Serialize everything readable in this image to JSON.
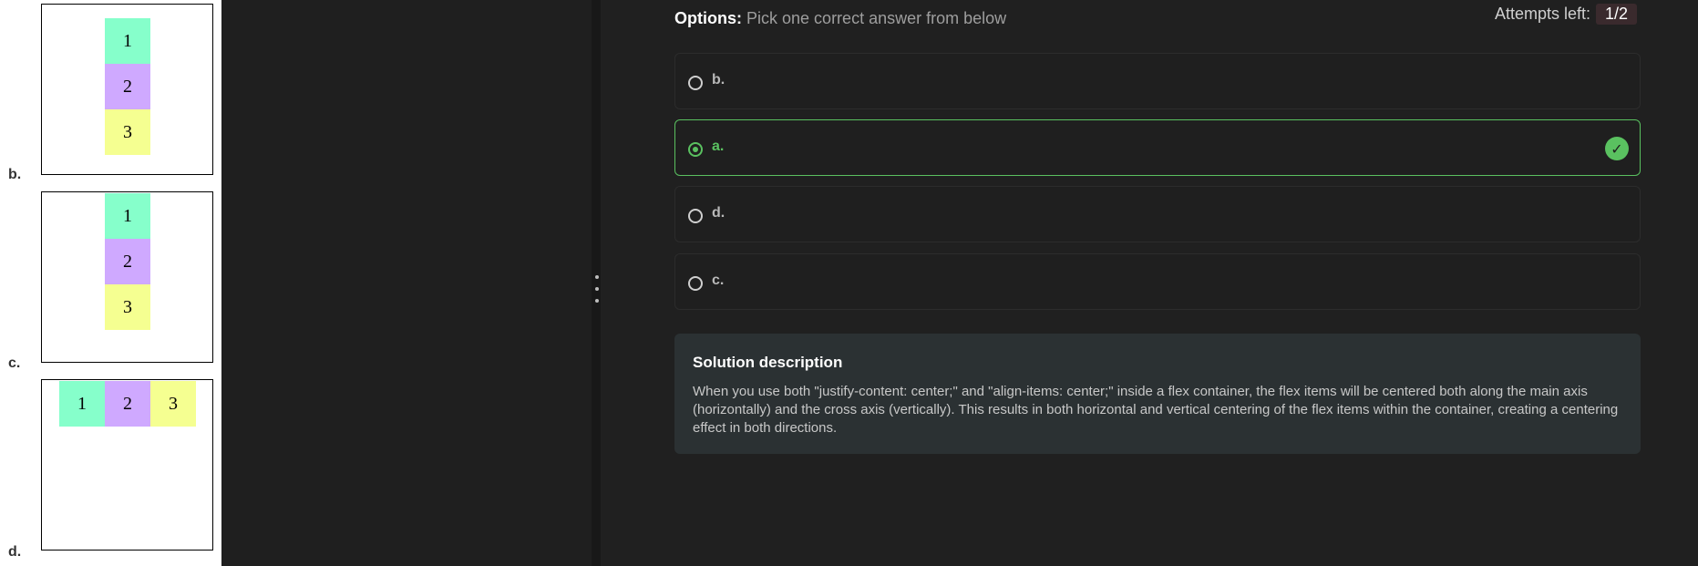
{
  "left_panel": {
    "options": [
      {
        "label": "b.",
        "cells": [
          "1",
          "2",
          "3"
        ],
        "layout": "vertical"
      },
      {
        "label": "c.",
        "cells": [
          "1",
          "2",
          "3"
        ],
        "layout": "vertical"
      },
      {
        "label": "d.",
        "cells": [
          "1",
          "2",
          "3"
        ],
        "layout": "horizontal"
      }
    ],
    "colors": {
      "green": "#86ffcb",
      "purple": "#cfa9ff",
      "yellow": "#f5ff91"
    }
  },
  "quiz": {
    "options_title": "Options:",
    "options_hint": "Pick one correct answer from below",
    "attempts_label": "Attempts left:",
    "attempts_value": "1/2",
    "answers": [
      {
        "label": "b.",
        "selected": false
      },
      {
        "label": "a.",
        "selected": true,
        "correct": true
      },
      {
        "label": "d.",
        "selected": false
      },
      {
        "label": "c.",
        "selected": false
      }
    ],
    "accent_color": "#5ac160"
  },
  "solution": {
    "title": "Solution description",
    "text": "When you use both \"justify-content: center;\" and \"align-items: center;\" inside a flex container, the flex items will be centered both along the main axis (horizontally) and the cross axis (vertically). This results in both horizontal and vertical centering of the flex items within the container, creating a centering effect in both directions."
  },
  "icons": {
    "check": "check-circle-icon",
    "splitter": "drag-handle-icon"
  }
}
